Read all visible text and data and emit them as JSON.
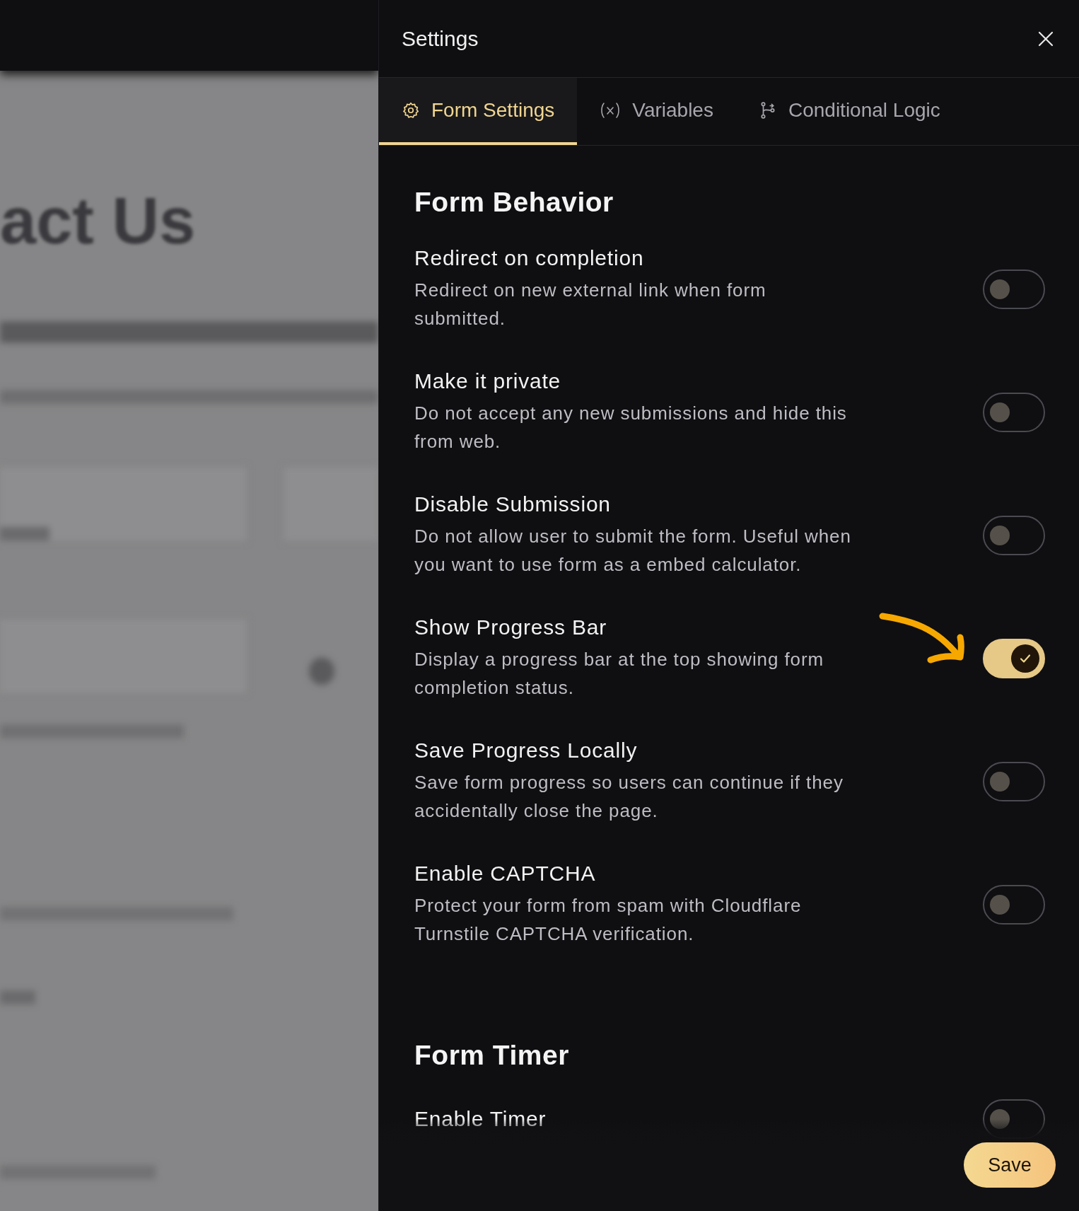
{
  "backdrop": {
    "heading": "act Us"
  },
  "panel": {
    "title": "Settings"
  },
  "tabs": [
    {
      "label": "Form Settings",
      "selected": true
    },
    {
      "label": "Variables",
      "selected": false
    },
    {
      "label": "Conditional Logic",
      "selected": false
    }
  ],
  "sections": [
    {
      "title": "Form Behavior",
      "settings": [
        {
          "title": "Redirect on completion",
          "description": "Redirect on new external link when form submitted.",
          "on": false
        },
        {
          "title": "Make it private",
          "description": "Do not accept any new submissions and hide this from web.",
          "on": false
        },
        {
          "title": "Disable Submission",
          "description": "Do not allow user to submit the form. Useful when you want to use form as a embed calculator.",
          "on": false
        },
        {
          "title": "Show Progress Bar",
          "description": "Display a progress bar at the top showing form completion status.",
          "on": true
        },
        {
          "title": "Save Progress Locally",
          "description": "Save form progress so users can continue if they accidentally close the page.",
          "on": false
        },
        {
          "title": "Enable CAPTCHA",
          "description": "Protect your form from spam with Cloudflare Turnstile CAPTCHA verification.",
          "on": false
        }
      ]
    },
    {
      "title": "Form Timer",
      "settings": [
        {
          "title": "Enable Timer",
          "on": false
        }
      ]
    }
  ],
  "save_button": "Save"
}
